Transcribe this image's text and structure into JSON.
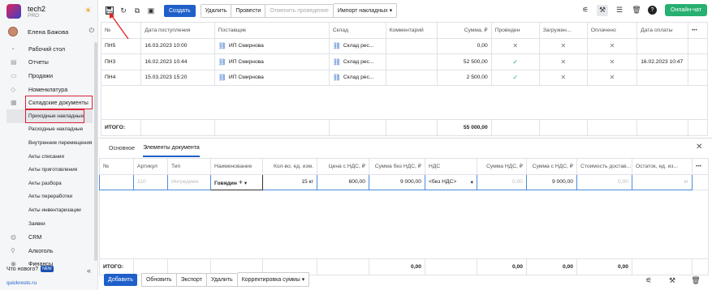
{
  "brand": {
    "name": "tech2",
    "plan": "PRO"
  },
  "user": {
    "name": "Елена Бажова"
  },
  "nav": [
    {
      "label": "Рабочий стол",
      "icon": "dashboard-icon",
      "kind": "top"
    },
    {
      "label": "Отчеты",
      "icon": "reports-icon",
      "kind": "top"
    },
    {
      "label": "Продажи",
      "icon": "sales-icon",
      "kind": "top"
    },
    {
      "label": "Номенклатура",
      "icon": "tag-icon",
      "kind": "top"
    },
    {
      "label": "Складские документы",
      "icon": "warehouse-icon",
      "kind": "outlined"
    },
    {
      "label": "Приходные накладные",
      "kind": "selected"
    },
    {
      "label": "Расходные накладные",
      "kind": "sub"
    },
    {
      "label": "Внутренние перемещения",
      "kind": "sub"
    },
    {
      "label": "Акты списания",
      "kind": "sub"
    },
    {
      "label": "Акты приготовления",
      "kind": "sub"
    },
    {
      "label": "Акты разбора",
      "kind": "sub"
    },
    {
      "label": "Акты переработки",
      "kind": "sub"
    },
    {
      "label": "Акты инвентаризации",
      "kind": "sub"
    },
    {
      "label": "Заявки",
      "kind": "sub"
    },
    {
      "label": "CRM",
      "icon": "crm-icon",
      "kind": "top"
    },
    {
      "label": "Алкоголь",
      "icon": "alcohol-icon",
      "kind": "top"
    },
    {
      "label": "Финансы",
      "icon": "finance-icon",
      "kind": "top"
    }
  ],
  "whats_new": "Что нового?",
  "new_badge": "NEW",
  "site": "quickresto.ru",
  "toolbar": {
    "create": "Создать",
    "delete": "Удалить",
    "post": "Провести",
    "unpost": "Отменить проведение",
    "import": "Импорт накладных",
    "online_chat": "Онлайн-чат"
  },
  "docs_table": {
    "headers": [
      "№",
      "Дата поступления",
      "Поставщик",
      "Склад",
      "Комментарий",
      "Сумма, ₽",
      "Проведен",
      "Загружен...",
      "Оплачено",
      "Дата оплаты"
    ],
    "rows": [
      {
        "num": "ПН5",
        "date": "16.03.2023 10:00",
        "supplier": "ИП Смирнова",
        "warehouse": "Склад рес...",
        "comment": "",
        "sum": "0,00",
        "posted": "no",
        "loaded": "no",
        "paid": "no",
        "pay_date": ""
      },
      {
        "num": "ПН3",
        "date": "16.02.2023 10:44",
        "supplier": "ИП Смирнова",
        "warehouse": "Склад рес...",
        "comment": "",
        "sum": "52 500,00",
        "posted": "yes",
        "loaded": "no",
        "paid": "no",
        "pay_date": "16.02.2023 10:47"
      },
      {
        "num": "ПН4",
        "date": "15.03.2023 15:20",
        "supplier": "ИП Смирнова",
        "warehouse": "Склад рес...",
        "comment": "",
        "sum": "2 500,00",
        "posted": "yes",
        "loaded": "no",
        "paid": "no",
        "pay_date": ""
      }
    ],
    "total_label": "ИТОГО:",
    "total_sum": "55 000,00"
  },
  "tabs": [
    "Основное",
    "Элементы документа"
  ],
  "items_table": {
    "headers": [
      "№",
      "Артикул",
      "Тип",
      "Наименование",
      "Кол-во, ед. изм.",
      "Цена с НДС, ₽",
      "Сумма без НДС, ₽",
      "НДС",
      "Сумма НДС, ₽",
      "Сумма с НДС, ₽",
      "Стоимость достав...",
      "Остаток, ед. из..."
    ],
    "row": {
      "article": "110",
      "type": "Ингредиен",
      "name": "Говядин",
      "qty": "15 кг",
      "price": "600,00",
      "sum_no_vat": "9 000,00",
      "vat": "<без НДС>",
      "vat_sum": "0,00",
      "sum_vat": "9 000,00",
      "delivery": "0,00",
      "rest": "кг"
    },
    "total_label": "ИТОГО:",
    "totals": {
      "sum_no_vat": "0,00",
      "vat_sum": "0,00",
      "sum_vat": "0,00",
      "delivery": "0,00"
    }
  },
  "bottom": {
    "add": "Добавить",
    "refresh": "Обновить",
    "export": "Экспорт",
    "delete": "Удалить",
    "adjust": "Корректировка суммы"
  }
}
